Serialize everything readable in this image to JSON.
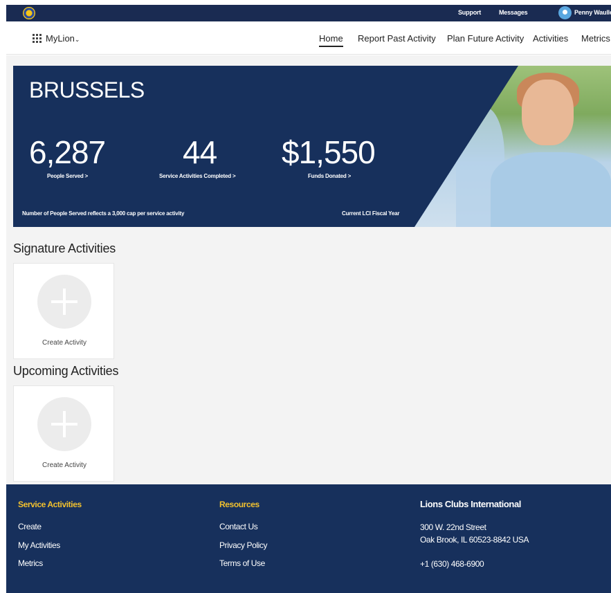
{
  "topbar": {
    "support": "Support",
    "messages": "Messages",
    "user_name": "Penny Waulle"
  },
  "nav": {
    "brand": "MyLion",
    "items": [
      {
        "label": "Home",
        "active": true
      },
      {
        "label": "Report Past Activity"
      },
      {
        "label": "Plan Future Activity"
      },
      {
        "label": "Activities"
      },
      {
        "label": "Metrics"
      }
    ]
  },
  "hero": {
    "title": "BRUSSELS",
    "stats": [
      {
        "value": "6,287",
        "label": "People Served >"
      },
      {
        "value": "44",
        "label": "Service Activities Completed >"
      },
      {
        "value": "$1,550",
        "label": "Funds Donated >"
      }
    ],
    "note_left": "Number of People Served reflects a 3,000 cap per service activity",
    "note_right": "Current LCI Fiscal Year"
  },
  "sections": {
    "signature": {
      "title": "Signature Activities",
      "card_label": "Create Activity"
    },
    "upcoming": {
      "title": "Upcoming Activities",
      "card_label": "Create Activity"
    }
  },
  "footer": {
    "service": {
      "heading": "Service Activities",
      "links": [
        "Create",
        "My Activities",
        "Metrics"
      ]
    },
    "resources": {
      "heading": "Resources",
      "links": [
        "Contact Us",
        "Privacy Policy",
        "Terms of Use"
      ]
    },
    "org": {
      "heading": "Lions Clubs International",
      "address_line1": "300 W. 22nd Street",
      "address_line2": "Oak Brook, IL 60523-8842 USA",
      "phone": "+1 (630) 468-6900"
    }
  },
  "colors": {
    "navy": "#17305c",
    "footer_heading": "#f2c12e"
  }
}
